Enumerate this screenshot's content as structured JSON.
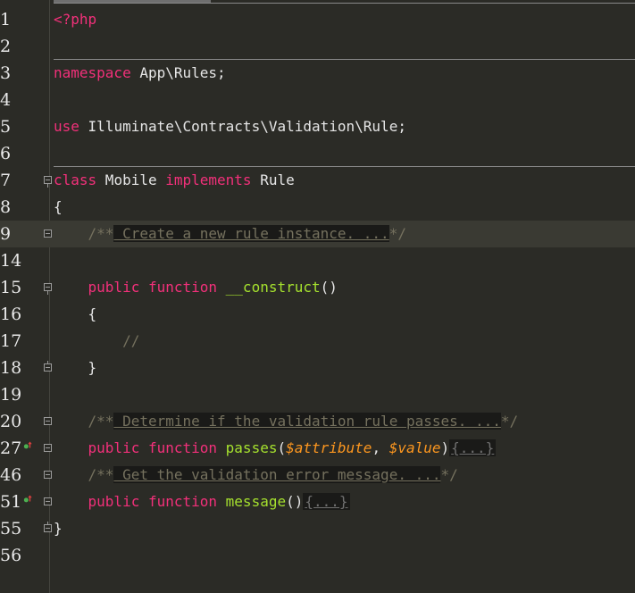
{
  "editor": {
    "lines": [
      {
        "num": "1",
        "code": [
          {
            "t": "<?php",
            "c": "kw"
          }
        ]
      },
      {
        "num": "2",
        "code": []
      },
      {
        "num": "3",
        "code": [
          {
            "t": "namespace",
            "c": "kw"
          },
          {
            "t": " App\\Rules;",
            "c": "plain"
          }
        ]
      },
      {
        "num": "4",
        "code": []
      },
      {
        "num": "5",
        "code": [
          {
            "t": "use",
            "c": "kw"
          },
          {
            "t": " Illuminate\\Contracts\\Validation\\Rule;",
            "c": "plain"
          }
        ]
      },
      {
        "num": "6",
        "code": []
      },
      {
        "num": "7",
        "code": [
          {
            "t": "class",
            "c": "kw"
          },
          {
            "t": " Mobile ",
            "c": "plain"
          },
          {
            "t": "implements",
            "c": "kw"
          },
          {
            "t": " Rule",
            "c": "plain"
          }
        ]
      },
      {
        "num": "8",
        "code": [
          {
            "t": "{",
            "c": "plain"
          }
        ]
      },
      {
        "num": "9",
        "code": [
          {
            "t": "    /**",
            "c": "cm"
          },
          {
            "t": " Create a new rule instance. ...",
            "c": "fold-text"
          },
          {
            "t": "*/",
            "c": "cm"
          }
        ]
      },
      {
        "num": "14",
        "code": []
      },
      {
        "num": "15",
        "code": [
          {
            "t": "    public",
            "c": "kw"
          },
          {
            "t": " ",
            "c": "plain"
          },
          {
            "t": "function",
            "c": "kw"
          },
          {
            "t": " __construct",
            "c": "fn"
          },
          {
            "t": "()",
            "c": "plain"
          }
        ]
      },
      {
        "num": "16",
        "code": [
          {
            "t": "    {",
            "c": "plain"
          }
        ]
      },
      {
        "num": "17",
        "code": [
          {
            "t": "        //",
            "c": "cm"
          }
        ]
      },
      {
        "num": "18",
        "code": [
          {
            "t": "    }",
            "c": "plain"
          }
        ]
      },
      {
        "num": "19",
        "code": []
      },
      {
        "num": "20",
        "code": [
          {
            "t": "    /**",
            "c": "cm"
          },
          {
            "t": " Determine if the validation rule passes. ...",
            "c": "fold-text"
          },
          {
            "t": "*/",
            "c": "cm"
          }
        ]
      },
      {
        "num": "27",
        "code": [
          {
            "t": "    public",
            "c": "kw"
          },
          {
            "t": " ",
            "c": "plain"
          },
          {
            "t": "function",
            "c": "kw"
          },
          {
            "t": " passes",
            "c": "fn"
          },
          {
            "t": "(",
            "c": "plain"
          },
          {
            "t": "$attribute",
            "c": "var"
          },
          {
            "t": ", ",
            "c": "plain"
          },
          {
            "t": "$value",
            "c": "var"
          },
          {
            "t": ")",
            "c": "plain"
          },
          {
            "t": "{...}",
            "c": "fold-box"
          }
        ]
      },
      {
        "num": "46",
        "code": []
      },
      {
        "num": "46b",
        "code": [
          {
            "t": "    /**",
            "c": "cm"
          },
          {
            "t": " Get the validation error message. ...",
            "c": "fold-text"
          },
          {
            "t": "*/",
            "c": "cm"
          }
        ]
      },
      {
        "num": "51",
        "code": [
          {
            "t": "    public",
            "c": "kw"
          },
          {
            "t": " ",
            "c": "plain"
          },
          {
            "t": "function",
            "c": "kw"
          },
          {
            "t": " message",
            "c": "fn"
          },
          {
            "t": "()",
            "c": "plain"
          },
          {
            "t": "{...}",
            "c": "fold-box"
          }
        ]
      },
      {
        "num": "55",
        "code": [
          {
            "t": "}",
            "c": "plain"
          }
        ]
      },
      {
        "num": "56",
        "code": []
      }
    ],
    "gutter_numbers": [
      "1",
      "2",
      "3",
      "4",
      "5",
      "6",
      "7",
      "8",
      "9",
      "14",
      "15",
      "16",
      "17",
      "18",
      "19",
      "20",
      "27",
      "46",
      "51",
      "55",
      "56"
    ],
    "current_line": "9",
    "colors": {
      "background": "#2b2b26",
      "keyword": "#f2307a",
      "function": "#a6e22e",
      "variable": "#fd971f",
      "comment": "#75715e",
      "text": "#e6e6e6",
      "override_icon": "#4caf50",
      "implements_arrow": "#e04040"
    },
    "gutter_icons": {
      "passes": "implements-method-icon",
      "message": "implements-method-icon"
    }
  }
}
